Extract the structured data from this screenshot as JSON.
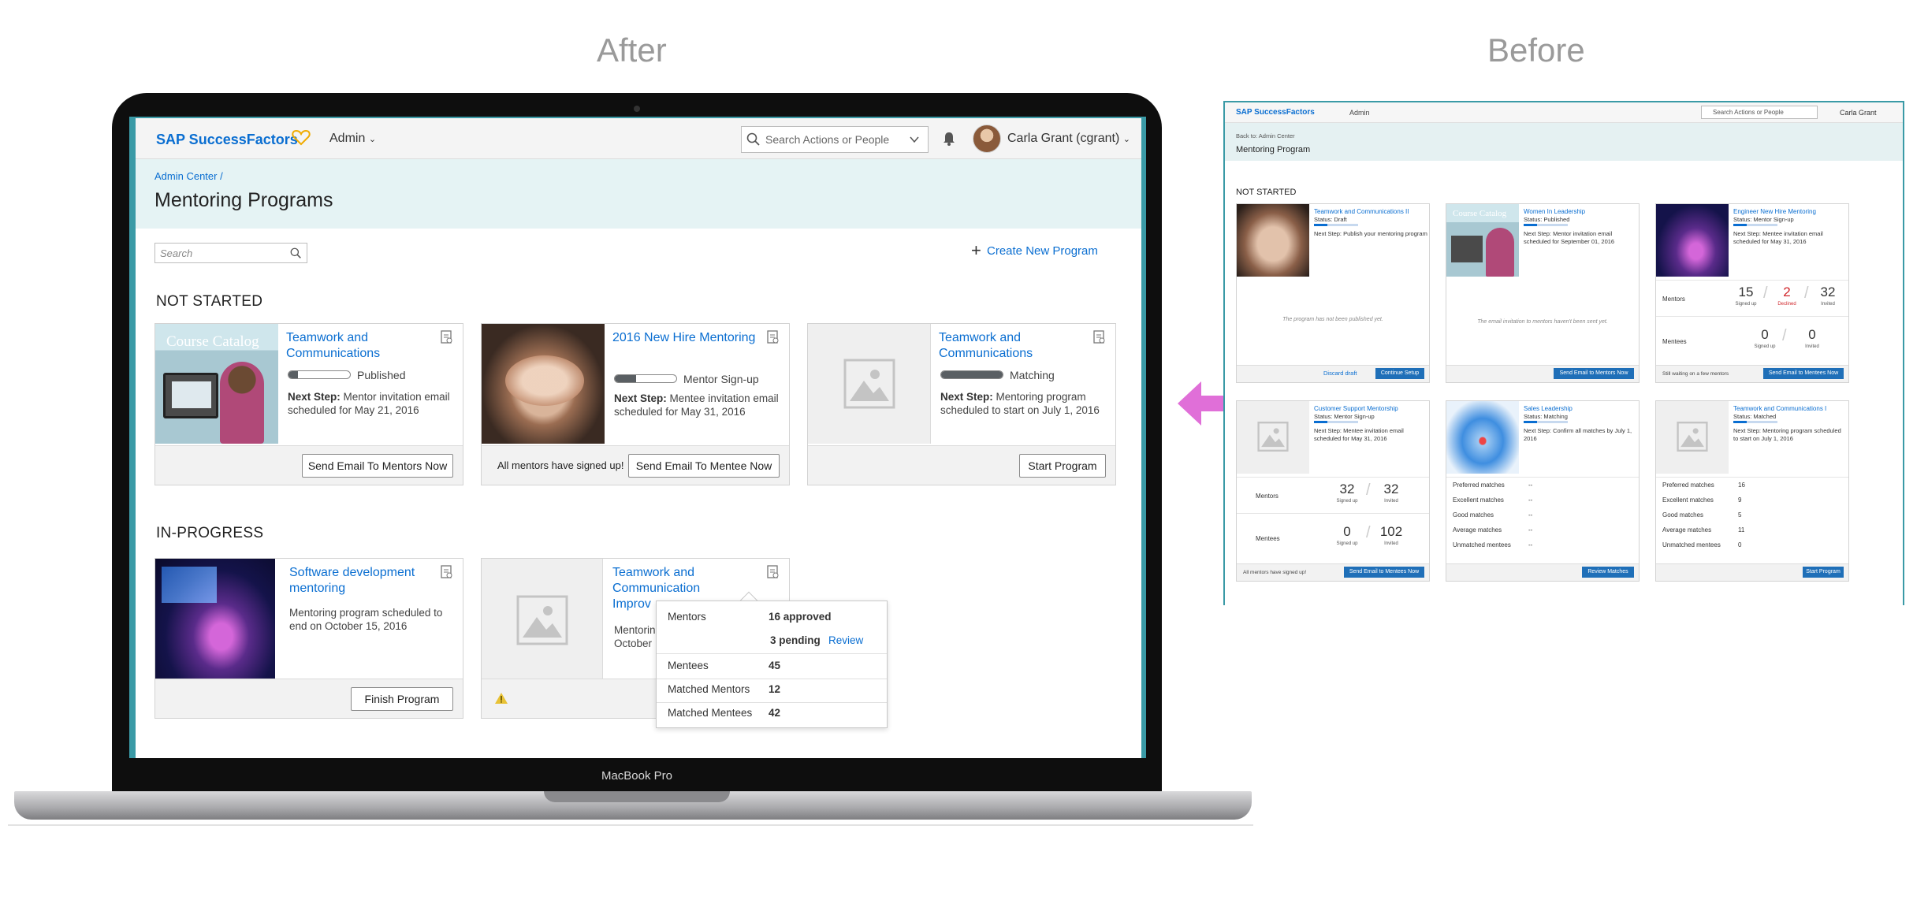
{
  "labels": {
    "after": "After",
    "before": "Before",
    "laptop_model": "MacBook Pro"
  },
  "app": {
    "brand": "SAP SuccessFactors",
    "admin_menu": "Admin",
    "search_placeholder": "Search Actions or People",
    "user_name": "Carla Grant (cgrant)",
    "breadcrumb": "Admin Center /",
    "page_title": "Mentoring Programs",
    "list_search_placeholder": "Search",
    "create_button": "Create New Program"
  },
  "not_started": {
    "title": "NOT STARTED",
    "cards": [
      {
        "image_caption": "Course Catalog",
        "title": "Teamwork and Communications",
        "status": "Published",
        "progress": 0.15,
        "next_label": "Next Step:",
        "next_text": "Mentor invitation email scheduled for May 21, 2016",
        "button": "Send Email To Mentors Now",
        "note": ""
      },
      {
        "title": "2016 New Hire Mentoring",
        "status": "Mentor Sign-up",
        "progress": 0.35,
        "next_label": "Next Step:",
        "next_text": "Mentee invitation email scheduled for May 31, 2016",
        "button": "Send Email To Mentee Now",
        "note": "All mentors have signed up!"
      },
      {
        "title": "Teamwork and Communications",
        "status": "Matching",
        "progress": 1.0,
        "next_label": "Next Step:",
        "next_text": "Mentoring program scheduled to start on July 1, 2016",
        "button": "Start Program",
        "note": ""
      }
    ]
  },
  "in_progress": {
    "title": "IN-PROGRESS",
    "cards": [
      {
        "title": "Software development mentoring",
        "text": "Mentoring program scheduled to end on October 15, 2016",
        "button": "Finish Program"
      },
      {
        "title_line1": "Teamwork and",
        "title_line2": "Communication",
        "title_line3": "Improv",
        "text_line1": "Mentorin",
        "text_line2": "October"
      }
    ]
  },
  "popover": {
    "mentors_label": "Mentors",
    "approved": "16 approved",
    "pending": "3 pending",
    "review": "Review",
    "mentees_label": "Mentees",
    "mentees_value": "45",
    "matched_mentors_label": "Matched Mentors",
    "matched_mentors_value": "12",
    "matched_mentees_label": "Matched Mentees",
    "matched_mentees_value": "42"
  },
  "before_panel": {
    "brand": "SAP SuccessFactors",
    "admin": "Admin",
    "search": "Search Actions or People",
    "user": "Carla Grant",
    "back": "Back to: Admin Center",
    "title": "Mentoring Program",
    "section": "NOT STARTED",
    "cards": [
      {
        "image_caption": "",
        "title": "Teamwork and Communications II",
        "status": "Status: Draft",
        "next": "Next Step: Publish your mentoring program",
        "message": "The program has not been published yet.",
        "link": "Discard draft",
        "button": "Continue Setup"
      },
      {
        "image_caption": "Course Catalog",
        "title": "Women In Leadership",
        "status": "Status: Published",
        "next": "Next Step: Mentor invitation email scheduled for September 01, 2016",
        "message": "The email invitation to mentors haven't been sent yet.",
        "button": "Send Email to Mentors Now"
      },
      {
        "title": "Engineer New Hire Mentoring",
        "status": "Status: Mentor Sign-up",
        "next": "Next Step: Mentee invitation email scheduled for May 31, 2016",
        "mentors_label": "Mentors",
        "m1": "15",
        "m1l": "Signed up",
        "m2": "2",
        "m2l": "Declined",
        "m3": "32",
        "m3l": "Invited",
        "mentees_label": "Mentees",
        "e1": "0",
        "e1l": "Signed up",
        "e2": "0",
        "e2l": "Invited",
        "note": "Still waiting on a few mentors",
        "button": "Send Email to Mentees Now"
      },
      {
        "title": "Customer Support Mentorship",
        "status": "Status: Mentor Sign-up",
        "next": "Next Step: Mentee invitation email scheduled for May 31, 2016",
        "mentors_label": "Mentors",
        "m1": "32",
        "m1l": "Signed up",
        "m2": "32",
        "m2l": "Invited",
        "mentees_label": "Mentees",
        "e1": "0",
        "e1l": "Signed up",
        "e2": "102",
        "e2l": "Invited",
        "note": "All mentors have signed up!",
        "button": "Send Email to Mentees Now"
      },
      {
        "title": "Sales Leadership",
        "status": "Status: Matching",
        "next": "Next Step: Confirm all matches by July 1, 2016",
        "rows": [
          [
            "Preferred matches",
            "--"
          ],
          [
            "Excellent matches",
            "--"
          ],
          [
            "Good matches",
            "--"
          ],
          [
            "Average matches",
            "--"
          ],
          [
            "Unmatched mentees",
            "--"
          ]
        ],
        "button": "Review Matches"
      },
      {
        "title": "Teamwork and Communications I",
        "status": "Status: Matched",
        "next": "Next Step: Mentoring program scheduled to start on July 1, 2016",
        "rows": [
          [
            "Preferred matches",
            "16"
          ],
          [
            "Excellent matches",
            "9"
          ],
          [
            "Good matches",
            "5"
          ],
          [
            "Average matches",
            "11"
          ],
          [
            "Unmatched mentees",
            "0"
          ]
        ],
        "button": "Start Program"
      }
    ]
  },
  "colors": {
    "link": "#0a6ed1",
    "teal": "#3a9aa6",
    "subheader": "#e5f3f4",
    "arrow": "#e06fd8"
  }
}
